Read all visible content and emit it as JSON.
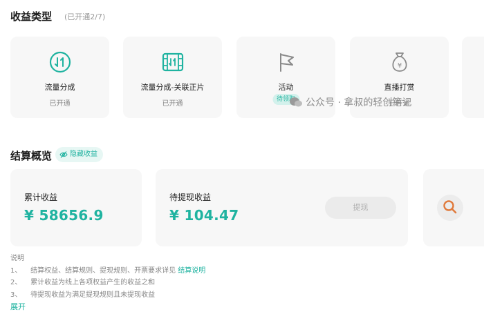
{
  "revenue_section": {
    "title": "收益类型",
    "opened_count": "(已开通2/7)",
    "cards": [
      {
        "name": "流量分成",
        "status": "已开通",
        "icon": "traffic-split-icon"
      },
      {
        "name": "流量分成-关联正片",
        "status": "已开通",
        "icon": "film-link-icon"
      },
      {
        "name": "活动",
        "status": "待领取",
        "icon": "flag-icon"
      },
      {
        "name": "直播打赏",
        "status": "已开通",
        "icon": "money-bag-icon"
      }
    ]
  },
  "settlement": {
    "title": "结算概览",
    "hide_earnings_label": "隐藏收益",
    "cumulative": {
      "label": "累计收益",
      "amount": "¥ 58656.9"
    },
    "pending": {
      "label": "待提现收益",
      "amount": "¥ 104.47",
      "withdraw_label": "提现"
    }
  },
  "notes": {
    "heading": "说明",
    "items": [
      {
        "num": "1、",
        "text": "结算权益、结算规则、提现规则、开票要求详见",
        "link": "结算说明"
      },
      {
        "num": "2、",
        "text": "累计收益为线上各项权益产生的收益之和"
      },
      {
        "num": "3、",
        "text": "待提现收益为满足提现规则且未提现收益"
      }
    ],
    "expand_label": "展开"
  },
  "watermark": {
    "text": "公众号 · 拿叔的轻创笔记"
  },
  "colors": {
    "accent": "#1fb3a0",
    "card_bg": "#f7f7f7",
    "muted": "#888888",
    "search_orange": "#e07a3c"
  }
}
